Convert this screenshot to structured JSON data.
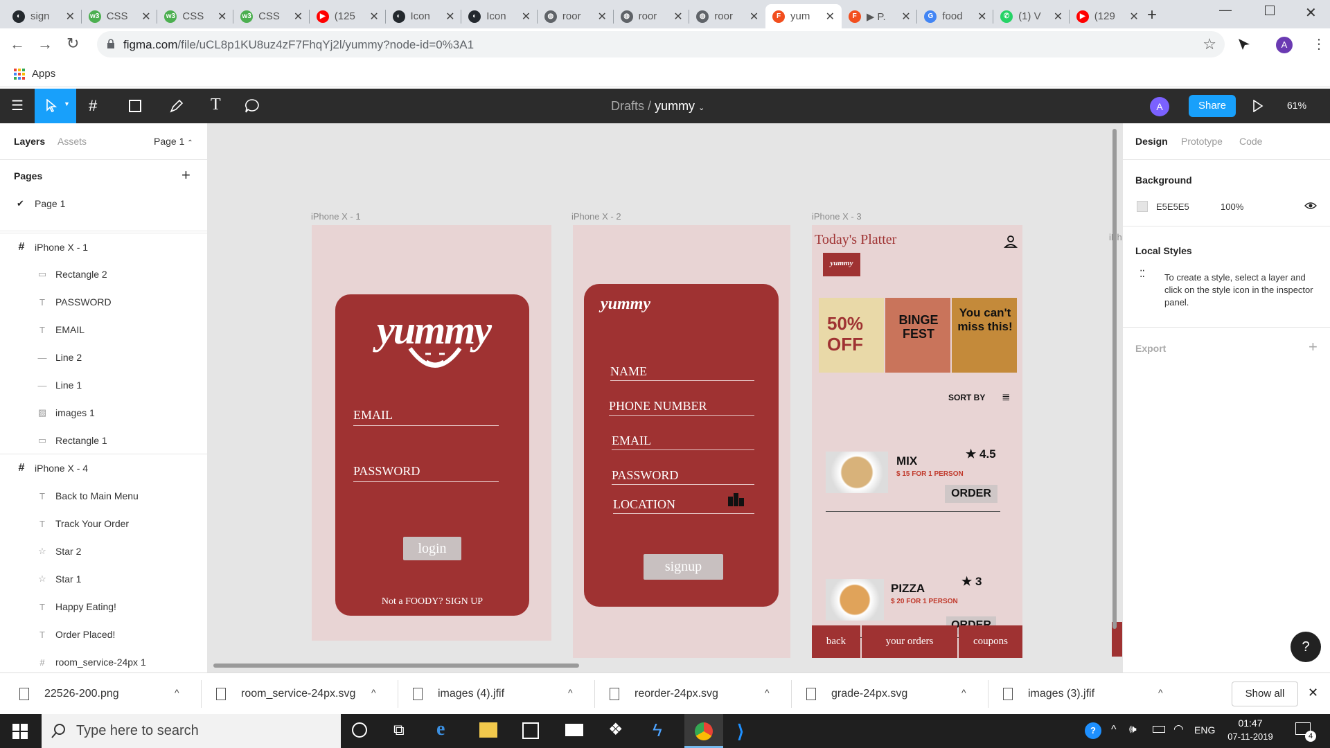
{
  "browser": {
    "tabs": [
      {
        "title": "sign",
        "icon": "github-icon",
        "color": "#24292e"
      },
      {
        "title": "CSS",
        "icon": "w3schools-icon",
        "color": "#4caf50"
      },
      {
        "title": "CSS",
        "icon": "w3schools-icon",
        "color": "#4caf50"
      },
      {
        "title": "CSS",
        "icon": "w3schools-icon",
        "color": "#4caf50"
      },
      {
        "title": "(125",
        "icon": "youtube-icon",
        "color": "#ff0000"
      },
      {
        "title": "Icon",
        "icon": "github-icon",
        "color": "#24292e"
      },
      {
        "title": "Icon",
        "icon": "github-icon",
        "color": "#24292e"
      },
      {
        "title": "roor",
        "icon": "globe-icon",
        "color": "#5f6368"
      },
      {
        "title": "roor",
        "icon": "globe-icon",
        "color": "#5f6368"
      },
      {
        "title": "roor",
        "icon": "globe-icon",
        "color": "#5f6368"
      },
      {
        "title": "yum",
        "icon": "figma-icon",
        "color": "#f24e1e",
        "active": true
      },
      {
        "title": "▶ P.",
        "icon": "figma-icon",
        "color": "#f24e1e"
      },
      {
        "title": "food",
        "icon": "google-icon",
        "color": "#4285f4"
      },
      {
        "title": "(1) V",
        "icon": "whatsapp-icon",
        "color": "#25d366"
      },
      {
        "title": "(129",
        "icon": "youtube-icon",
        "color": "#ff0000"
      }
    ],
    "url_host": "figma.com",
    "url_path": "/file/uCL8p1KU8uz4zF7FhqYj2l/yummy?node-id=0%3A1",
    "avatar_letter": "A",
    "bookmark_apps": "Apps"
  },
  "figma": {
    "breadcrumb_parent": "Drafts",
    "breadcrumb_sep": "/",
    "file_name": "yummy",
    "user_initial": "A",
    "share_label": "Share",
    "zoom": "61%",
    "left_tabs": {
      "layers": "Layers",
      "assets": "Assets",
      "page": "Page 1"
    },
    "pages_title": "Pages",
    "current_page": "Page 1",
    "layers": [
      {
        "name": "iPhone X - 1",
        "kind": "frame"
      },
      {
        "name": "Rectangle 2",
        "kind": "rect"
      },
      {
        "name": "PASSWORD",
        "kind": "text"
      },
      {
        "name": "EMAIL",
        "kind": "text"
      },
      {
        "name": "Line 2",
        "kind": "line"
      },
      {
        "name": "Line 1",
        "kind": "line"
      },
      {
        "name": "images 1",
        "kind": "image"
      },
      {
        "name": "Rectangle 1",
        "kind": "rect"
      },
      {
        "name": "iPhone X - 4",
        "kind": "frame"
      },
      {
        "name": "Back to Main Menu",
        "kind": "text"
      },
      {
        "name": "Track Your Order",
        "kind": "text"
      },
      {
        "name": "Star 2",
        "kind": "star"
      },
      {
        "name": "Star 1",
        "kind": "star"
      },
      {
        "name": "Happy Eating!",
        "kind": "text"
      },
      {
        "name": "Order Placed!",
        "kind": "text"
      },
      {
        "name": "room_service-24px 1",
        "kind": "frame"
      }
    ],
    "right_tabs": {
      "design": "Design",
      "prototype": "Prototype",
      "code": "Code"
    },
    "background_title": "Background",
    "background_hex": "E5E5E5",
    "background_opacity": "100%",
    "local_styles_title": "Local Styles",
    "local_styles_hint": "To create a style, select a layer and click on the style icon in the inspector panel.",
    "export_title": "Export",
    "help": "?"
  },
  "canvas": {
    "frame_labels": [
      "iPhone X - 1",
      "iPhone X - 2",
      "iPhone X - 3",
      "iPh"
    ],
    "login": {
      "logo": "yummy",
      "email": "EMAIL",
      "password": "PASSWORD",
      "button": "login",
      "footer": "Not a FOODY? SIGN UP"
    },
    "signup": {
      "logo": "yummy",
      "fields": [
        "NAME",
        "PHONE NUMBER",
        "EMAIL",
        "PASSWORD",
        "LOCATION"
      ],
      "button": "signup"
    },
    "platter": {
      "title": "Today's Platter",
      "logo": "yummy",
      "promos": [
        {
          "text": "50% OFF",
          "color": "#e9d9a8"
        },
        {
          "text": "BINGE FEST",
          "color": "#c9745b"
        },
        {
          "text": "You can't miss this!",
          "color": "#c48a3a"
        }
      ],
      "sort_by": "SORT BY",
      "items": [
        {
          "name": "MIX",
          "price": "$ 15 FOR 1 PERSON",
          "rating": "4.5",
          "order": "ORDER"
        },
        {
          "name": "PIZZA",
          "price": "$ 20 FOR 1 PERSON",
          "rating": "3",
          "order": "ORDER"
        }
      ],
      "nav": [
        "back",
        "your orders",
        "coupons"
      ]
    }
  },
  "downloads": {
    "files": [
      "22526-200.png",
      "room_service-24px.svg",
      "images (4).jfif",
      "reorder-24px.svg",
      "grade-24px.svg",
      "images (3).jfif"
    ],
    "show_all": "Show all"
  },
  "taskbar": {
    "search_placeholder": "Type here to search",
    "lang": "ENG",
    "time": "01:47",
    "date": "07-11-2019",
    "notifications": "4"
  }
}
